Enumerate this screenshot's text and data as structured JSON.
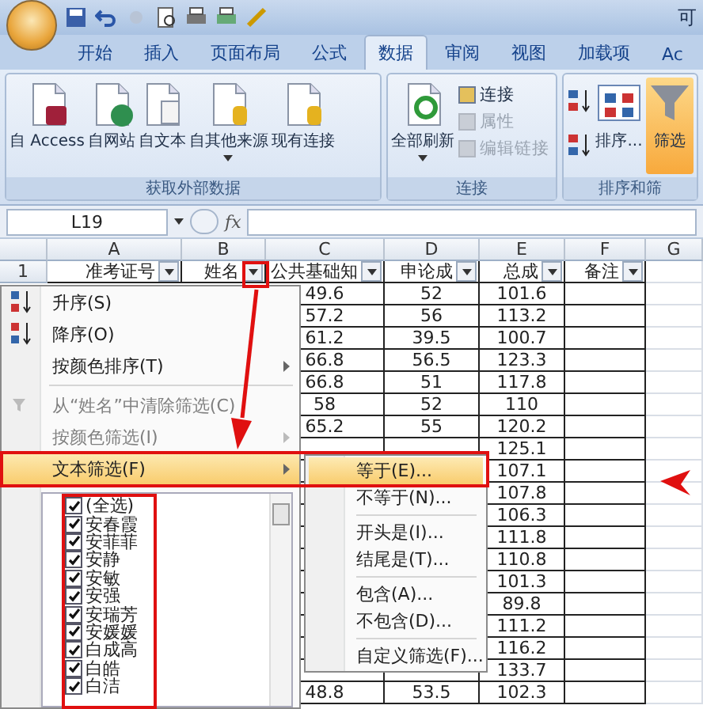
{
  "title_bar": {
    "title": "可"
  },
  "tabs": [
    {
      "label": "开始",
      "selected": false
    },
    {
      "label": "插入",
      "selected": false
    },
    {
      "label": "页面布局",
      "selected": false
    },
    {
      "label": "公式",
      "selected": false
    },
    {
      "label": "数据",
      "selected": true
    },
    {
      "label": "审阅",
      "selected": false
    },
    {
      "label": "视图",
      "selected": false
    },
    {
      "label": "加载项",
      "selected": false
    },
    {
      "label": "Ac",
      "selected": false
    }
  ],
  "ribbon_groups": [
    {
      "title": "获取外部数据",
      "items": [
        {
          "kind": "access",
          "label": "自 Access"
        },
        {
          "kind": "web",
          "label": "自网站"
        },
        {
          "kind": "text",
          "label": "自文本"
        },
        {
          "kind": "other",
          "label": "自其他来源",
          "dropdown": true
        },
        {
          "kind": "existing",
          "label": "现有连接"
        }
      ]
    },
    {
      "title": "连接",
      "items": [
        {
          "kind": "refresh",
          "label": "全部刷新",
          "dropdown": true
        },
        {
          "kind": "small",
          "label": "连接",
          "disabled": false
        },
        {
          "kind": "small",
          "label": "属性",
          "disabled": true
        },
        {
          "kind": "small",
          "label": "编辑链接",
          "disabled": true
        }
      ]
    },
    {
      "title": "排序和筛",
      "items": [
        {
          "kind": "sort",
          "label": "排序..."
        },
        {
          "kind": "filter",
          "label": "筛选",
          "selected": true
        }
      ]
    }
  ],
  "formula_bar": {
    "name_box": "L19",
    "fx_label": "fx"
  },
  "sheet": {
    "columns": [
      "A",
      "B",
      "C",
      "D",
      "E",
      "F",
      "G"
    ],
    "header_row": {
      "number": "1",
      "cells": [
        {
          "text": "准考证号",
          "filter": true
        },
        {
          "text": "姓名",
          "filter": true
        },
        {
          "text": "公共基础知",
          "filter": true
        },
        {
          "text": "申论成",
          "filter": true
        },
        {
          "text": "总成",
          "filter": true
        },
        {
          "text": "备注",
          "filter": true
        }
      ]
    },
    "rows": [
      {
        "c": "49.6",
        "d": "52",
        "e": "101.6"
      },
      {
        "c": "57.2",
        "d": "56",
        "e": "113.2"
      },
      {
        "c": "61.2",
        "d": "39.5",
        "e": "100.7"
      },
      {
        "c": "66.8",
        "d": "56.5",
        "e": "123.3"
      },
      {
        "c": "66.8",
        "d": "51",
        "e": "117.8"
      },
      {
        "c": "58",
        "d": "52",
        "e": "110"
      },
      {
        "c": "65.2",
        "d": "55",
        "e": "120.2"
      },
      {
        "c": "",
        "d": "",
        "e": "125.1"
      },
      {
        "c": "",
        "d": "",
        "e": "107.1"
      },
      {
        "c": "",
        "d": "",
        "e": "107.8"
      },
      {
        "c": "",
        "d": "",
        "e": "106.3"
      },
      {
        "c": "",
        "d": "",
        "e": "111.8"
      },
      {
        "c": "",
        "d": "",
        "e": "110.8"
      },
      {
        "c": "",
        "d": "",
        "e": "101.3"
      },
      {
        "c": "",
        "d": "",
        "e": "89.8"
      },
      {
        "c": "",
        "d": "",
        "e": "111.2"
      },
      {
        "c": "",
        "d": "",
        "e": "116.2"
      },
      {
        "c": "",
        "d": "",
        "e": "133.7"
      },
      {
        "c": "48.8",
        "d": "53.5",
        "e": "102.3"
      }
    ]
  },
  "filter_menu": {
    "items": [
      {
        "kind": "sort_asc",
        "label": "升序(S)",
        "disabled": false,
        "submenu": false,
        "selected": false
      },
      {
        "kind": "sort_desc",
        "label": "降序(O)",
        "disabled": false,
        "submenu": false,
        "selected": false
      },
      {
        "kind": "item",
        "label": "按颜色排序(T)",
        "disabled": false,
        "submenu": true,
        "selected": false
      },
      {
        "kind": "separator"
      },
      {
        "kind": "clear",
        "label": "从“姓名”中清除筛选(C)",
        "disabled": true,
        "submenu": false,
        "selected": false
      },
      {
        "kind": "item",
        "label": "按颜色筛选(I)",
        "disabled": true,
        "submenu": true,
        "selected": false
      },
      {
        "kind": "item",
        "label": "文本筛选(F)",
        "disabled": false,
        "submenu": true,
        "selected": true
      }
    ],
    "values": [
      {
        "label": "(全选)",
        "checked": true
      },
      {
        "label": "安春霞",
        "checked": true
      },
      {
        "label": "安菲菲",
        "checked": true
      },
      {
        "label": "安静",
        "checked": true
      },
      {
        "label": "安敏",
        "checked": true
      },
      {
        "label": "安强",
        "checked": true
      },
      {
        "label": "安瑞芳",
        "checked": true
      },
      {
        "label": "安媛媛",
        "checked": true
      },
      {
        "label": "白成高",
        "checked": true
      },
      {
        "label": "白皓",
        "checked": true
      },
      {
        "label": "白洁",
        "checked": true
      }
    ]
  },
  "text_filter_submenu": {
    "items": [
      {
        "kind": "item",
        "label": "等于(E)...",
        "selected": true
      },
      {
        "kind": "item",
        "label": "不等于(N)...",
        "selected": false
      },
      {
        "kind": "separator"
      },
      {
        "kind": "item",
        "label": "开头是(I)...",
        "selected": false
      },
      {
        "kind": "item",
        "label": "结尾是(T)...",
        "selected": false
      },
      {
        "kind": "separator"
      },
      {
        "kind": "item",
        "label": "包含(A)...",
        "selected": false
      },
      {
        "kind": "item",
        "label": "不包含(D)...",
        "selected": false
      },
      {
        "kind": "separator"
      },
      {
        "kind": "item",
        "label": "自定义筛选(F)...",
        "selected": false
      }
    ]
  }
}
